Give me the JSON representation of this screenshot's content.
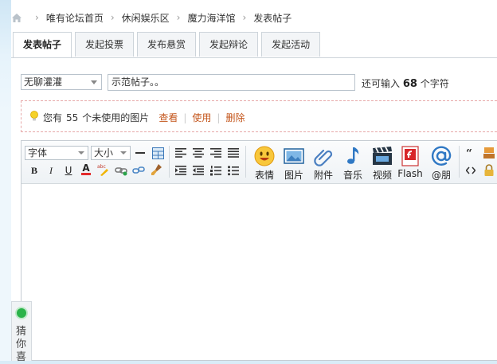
{
  "breadcrumb": {
    "items": [
      "唯有论坛首页",
      "休闲娱乐区",
      "魔力海洋馆",
      "发表帖子"
    ],
    "separator": "›"
  },
  "tabs": [
    {
      "label": "发表帖子",
      "active": true
    },
    {
      "label": "发起投票",
      "active": false
    },
    {
      "label": "发布悬赏",
      "active": false
    },
    {
      "label": "发起辩论",
      "active": false
    },
    {
      "label": "发起活动",
      "active": false
    }
  ],
  "subject": {
    "type_selected": "无聊灌灌",
    "title_value": "示范帖子。。",
    "remain_prefix": "还可输入",
    "remain_count": "68",
    "remain_suffix": "个字符"
  },
  "attachments": {
    "text_prefix": "您有",
    "count": "55",
    "text_suffix": "个未使用的图片",
    "view_label": "查看",
    "use_label": "使用",
    "delete_label": "删除"
  },
  "toolbar": {
    "font_label": "字体",
    "size_label": "大小",
    "bold": "B",
    "italic": "I",
    "underline": "U",
    "font_color": "A",
    "big_buttons": [
      {
        "label": "表情",
        "icon": "smiley-icon"
      },
      {
        "label": "图片",
        "icon": "image-icon"
      },
      {
        "label": "附件",
        "icon": "paperclip-icon"
      },
      {
        "label": "音乐",
        "icon": "music-note-icon"
      },
      {
        "label": "视频",
        "icon": "film-icon"
      },
      {
        "label": "Flash",
        "icon": "flash-icon"
      },
      {
        "label": "@朋",
        "icon": "at-icon"
      }
    ]
  },
  "guess": {
    "label": "猜你喜"
  },
  "colors": {
    "link": "#c4561c",
    "tab_border": "#cdd4da",
    "dashed_border": "#e7a9a9",
    "guess_dot": "#2bb34a"
  }
}
